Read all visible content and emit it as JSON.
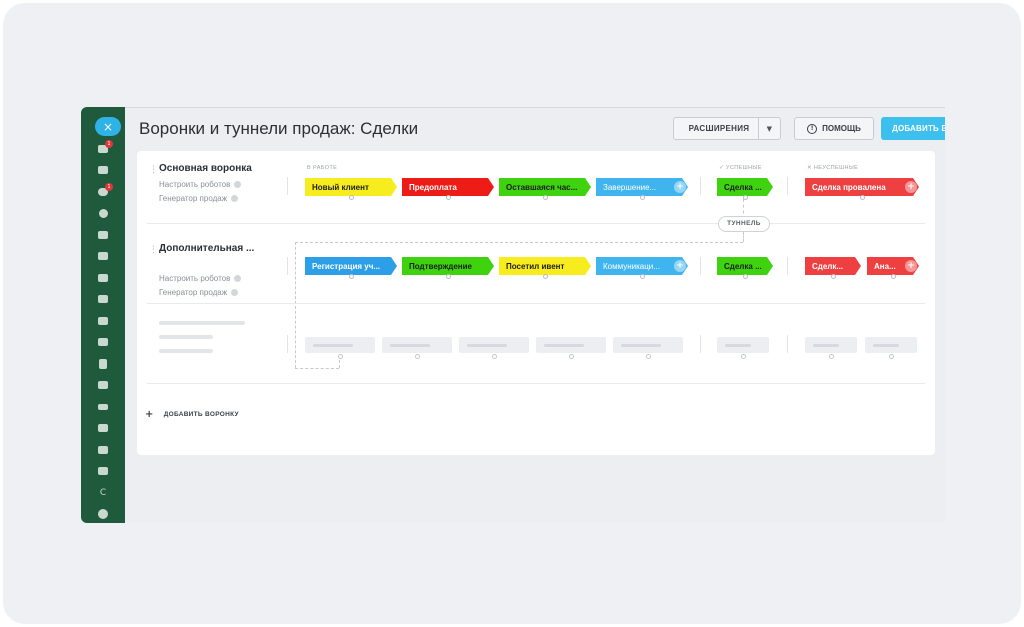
{
  "header": {
    "title": "Воронки и туннели продаж: Сделки",
    "extensions_label": "РАСШИРЕНИЯ",
    "help_label": "ПОМОЩЬ",
    "add_funnel_label": "ДОБАВИТЬ ВОРОНКУ"
  },
  "sidebar": {
    "close_icon": "×",
    "items": [
      {
        "icon": "inbox-icon",
        "badge": "1"
      },
      {
        "icon": "briefcase-icon",
        "badge": ""
      },
      {
        "icon": "funnel-icon",
        "badge": "1"
      },
      {
        "icon": "target-icon",
        "badge": ""
      },
      {
        "icon": "cart-icon",
        "badge": ""
      },
      {
        "icon": "task-icon",
        "badge": ""
      },
      {
        "icon": "video-icon",
        "badge": ""
      },
      {
        "icon": "monitor-icon",
        "badge": ""
      },
      {
        "icon": "chat-icon",
        "badge": ""
      },
      {
        "icon": "calendar-icon",
        "badge": ""
      },
      {
        "icon": "document-icon",
        "badge": ""
      },
      {
        "icon": "card-icon",
        "badge": ""
      },
      {
        "icon": "mail-icon",
        "badge": ""
      },
      {
        "icon": "users-icon",
        "badge": ""
      },
      {
        "icon": "contact-icon",
        "badge": ""
      },
      {
        "icon": "book-icon",
        "badge": ""
      },
      {
        "icon": "letter-c-icon",
        "label": "C"
      },
      {
        "icon": "chevron-down-icon",
        "badge": ""
      }
    ]
  },
  "columns": {
    "in_progress": "В РАБОТЕ",
    "success": "✓ УСПЕШНЫЕ",
    "fail": "✕ НЕУСПЕШНЫЕ"
  },
  "funnels": [
    {
      "name": "Основная воронка",
      "robots": "Настроить роботов",
      "generator": "Генератор продаж",
      "stages": [
        {
          "label": "Новый клиент",
          "color": "#f7ec1e",
          "text": "#1d1d1d"
        },
        {
          "label": "Предоплата",
          "color": "#ee1c17",
          "text": "#ffffff"
        },
        {
          "label": "Оставшаяся час...",
          "color": "#3fd20f",
          "text": "#1d1d1d"
        },
        {
          "label": "Завершение...",
          "color": "#3fb4ef",
          "text": "#ffffff"
        }
      ],
      "success": [
        {
          "label": "Сделка ...",
          "color": "#3fd20f",
          "text": "#1d1d1d"
        }
      ],
      "fail": [
        {
          "label": "Сделка провалена",
          "color": "#ee4040",
          "text": "#ffffff"
        }
      ]
    },
    {
      "name": "Дополнительная ...",
      "robots": "Настроить роботов",
      "generator": "Генератор продаж",
      "stages": [
        {
          "label": "Регистрация уч...",
          "color": "#2d9ee8",
          "text": "#ffffff"
        },
        {
          "label": "Подтверждение",
          "color": "#3fd20f",
          "text": "#1d1d1d"
        },
        {
          "label": "Посетил ивент",
          "color": "#f7ec1e",
          "text": "#1d1d1d"
        },
        {
          "label": "Коммуникаци...",
          "color": "#3fb4ef",
          "text": "#ffffff"
        }
      ],
      "success": [
        {
          "label": "Сделка ...",
          "color": "#3fd20f",
          "text": "#1d1d1d"
        }
      ],
      "fail": [
        {
          "label": "Сделк...",
          "color": "#ee4040",
          "text": "#ffffff"
        },
        {
          "label": "Ана...",
          "color": "#ee4040",
          "text": "#ffffff"
        }
      ]
    }
  ],
  "tunnel_label": "ТУННЕЛЬ",
  "add_funnel_row_label": "ДОБАВИТЬ ВОРОНКУ"
}
